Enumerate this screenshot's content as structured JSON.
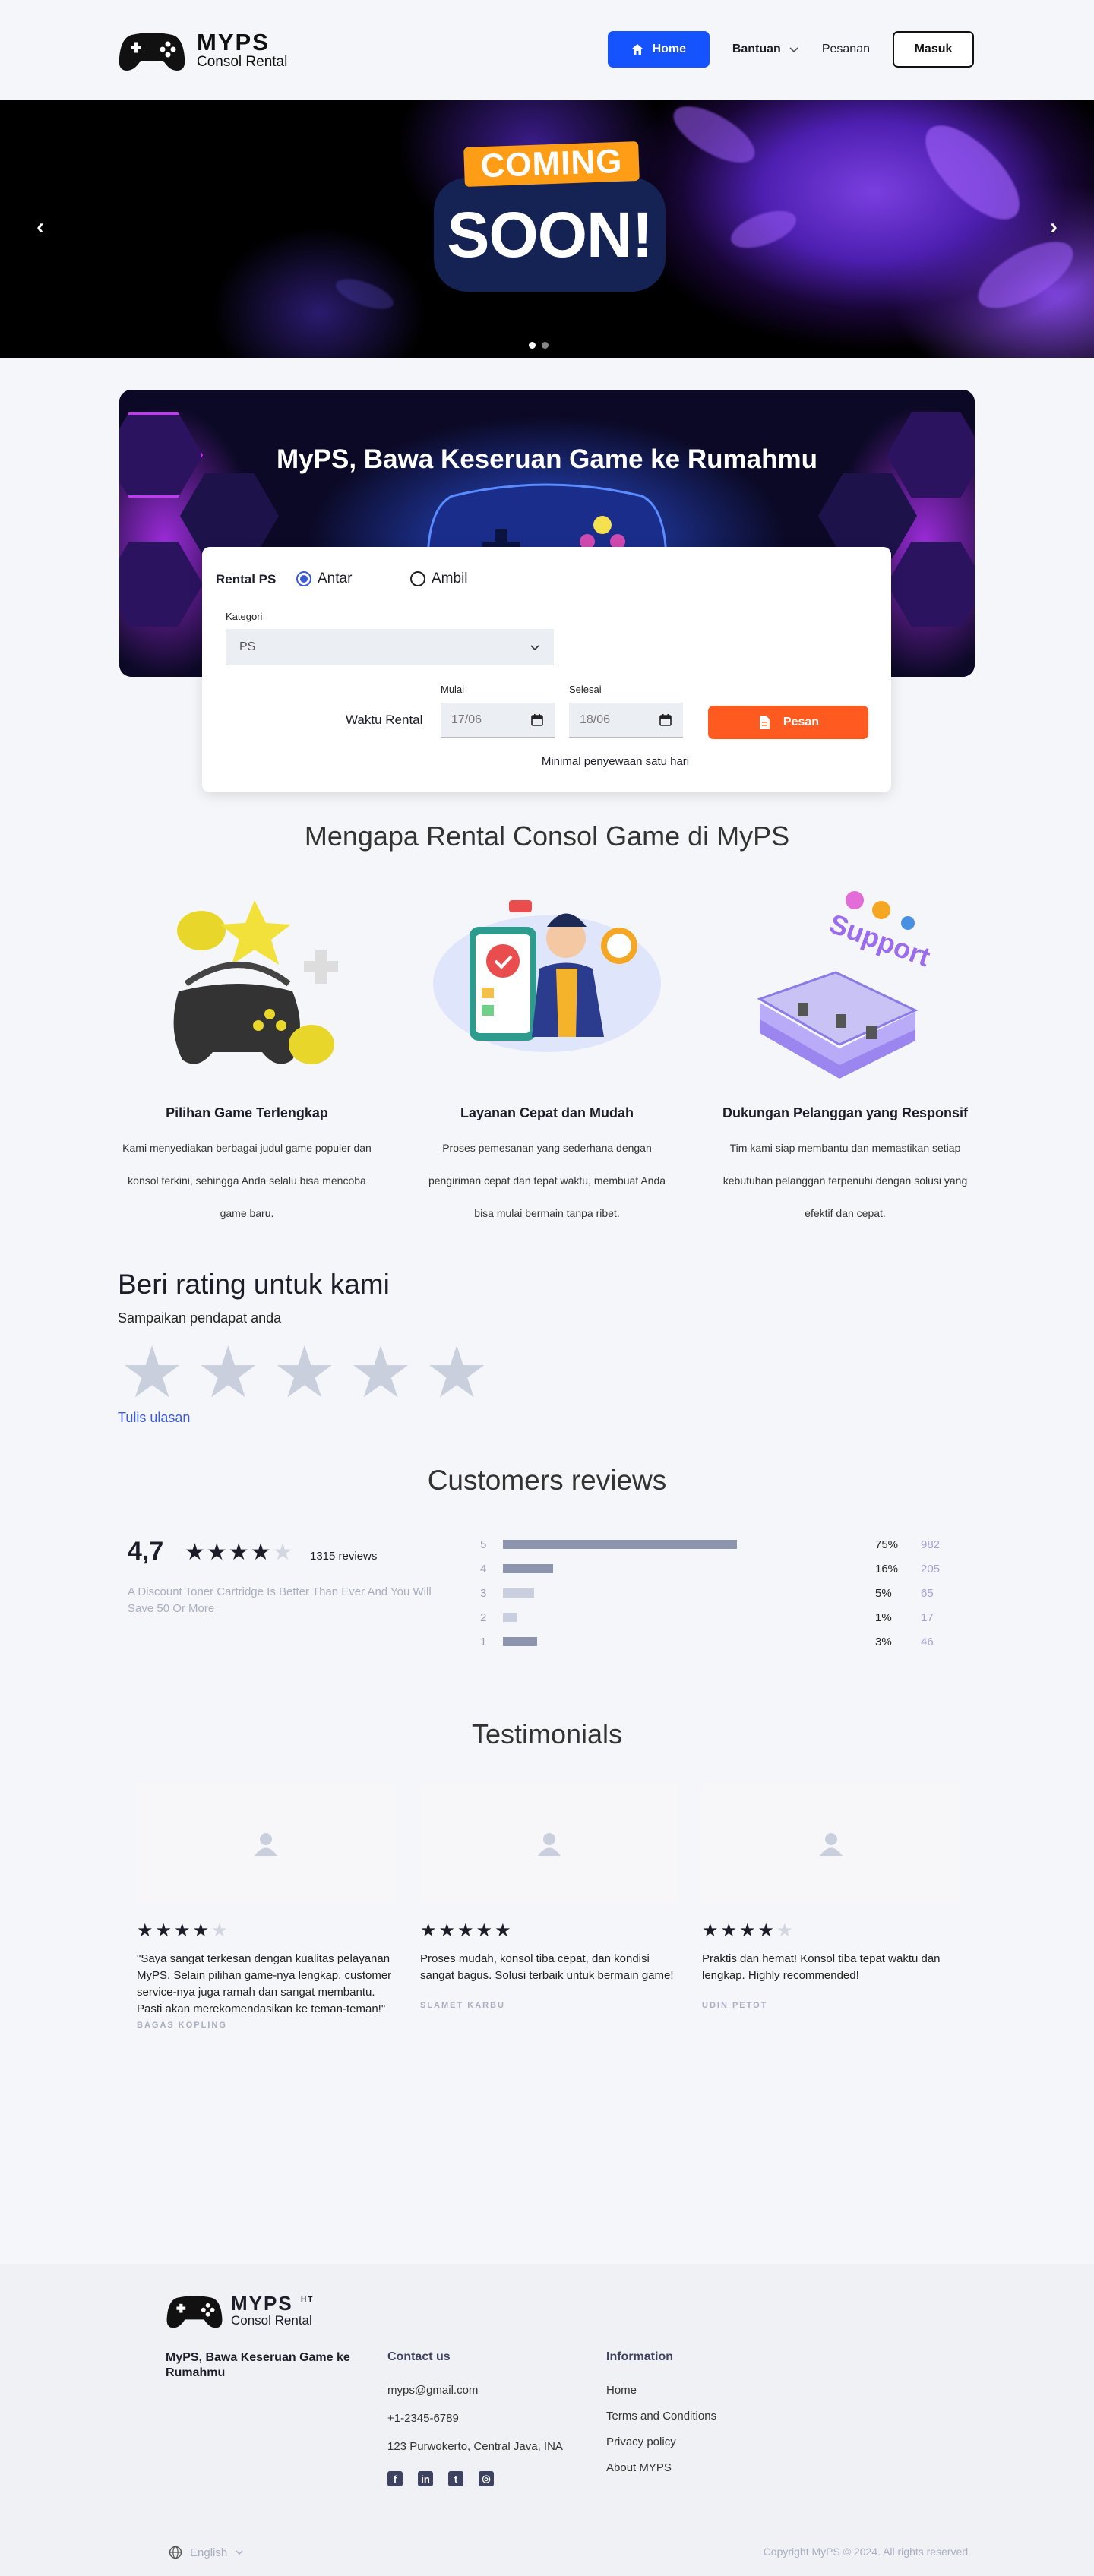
{
  "brand": {
    "name": "MYPS",
    "sub": "Consol Rental",
    "footer_badge": "HT"
  },
  "nav": {
    "home": "Home",
    "help": "Bantuan",
    "orders": "Pesanan",
    "login": "Masuk"
  },
  "hero": {
    "line1": "COMING",
    "line2": "SOON!",
    "slides": 2,
    "active_slide": 1
  },
  "banner": {
    "title": "MyPS, Bawa Keseruan Game ke Rumahmu"
  },
  "booking": {
    "rental_label": "Rental PS",
    "opt_deliver": "Antar",
    "opt_pickup": "Ambil",
    "selected": "Antar",
    "category_label": "Kategori",
    "category_value": "PS",
    "time_label": "Waktu Rental",
    "start_label": "Mulai",
    "start_value": "17/06",
    "end_label": "Selesai",
    "end_value": "18/06",
    "submit": "Pesan",
    "note": "Minimal penyewaan satu hari"
  },
  "why": {
    "title": "Mengapa Rental Consol Game di MyPS",
    "features": [
      {
        "title": "Pilihan Game Terlengkap",
        "text": "Kami menyediakan berbagai judul game populer dan konsol terkini, sehingga Anda selalu bisa mencoba game baru."
      },
      {
        "title": "Layanan Cepat dan Mudah",
        "text": "Proses pemesanan yang sederhana dengan pengiriman cepat dan tepat waktu, membuat Anda bisa mulai bermain tanpa ribet."
      },
      {
        "title": "Dukungan Pelanggan yang Responsif",
        "text": "Tim kami siap membantu dan memastikan setiap kebutuhan pelanggan terpenuhi dengan solusi yang efektif dan cepat."
      }
    ],
    "support_word": "Support"
  },
  "rate": {
    "title": "Beri rating untuk kami",
    "subtitle": "Sampaikan pendapat anda",
    "stars": 5,
    "write": "Tulis ulasan"
  },
  "reviews": {
    "title": "Customers reviews",
    "average": "4,7",
    "average_stars": 4,
    "count": "1315 reviews",
    "promo": "A Discount Toner Cartridge Is Better Than Ever And You Will Save 50 Or More",
    "bars": [
      {
        "star": "5",
        "pct": "75%",
        "count": "982",
        "fraction": 0.75
      },
      {
        "star": "4",
        "pct": "16%",
        "count": "205",
        "fraction": 0.16
      },
      {
        "star": "3",
        "pct": "5%",
        "count": "65",
        "fraction": 0.1
      },
      {
        "star": "2",
        "pct": "1%",
        "count": "17",
        "fraction": 0.045
      },
      {
        "star": "1",
        "pct": "3%",
        "count": "46",
        "fraction": 0.11
      }
    ]
  },
  "testimonials": {
    "title": "Testimonials",
    "items": [
      {
        "stars": 4,
        "quote": "\"Saya sangat terkesan dengan kualitas pelayanan MyPS. Selain pilihan game-nya lengkap, customer service-nya juga ramah dan sangat membantu. Pasti akan merekomendasikan ke teman-teman!\"",
        "name": "BAGAS KOPLING"
      },
      {
        "stars": 5,
        "quote": "Proses mudah, konsol tiba cepat, dan kondisi sangat bagus. Solusi terbaik untuk bermain game!",
        "name": "SLAMET KARBU"
      },
      {
        "stars": 4,
        "quote": "Praktis dan hemat! Konsol tiba tepat waktu dan lengkap. Highly recommended!",
        "name": "UDIN PETOT"
      }
    ]
  },
  "footer": {
    "tagline": "MyPS, Bawa Keseruan Game ke Rumahmu",
    "contact_title": "Contact us",
    "email": "myps@gmail.com",
    "phone": "+1-2345-6789",
    "address": "123 Purwokerto, Central Java, INA",
    "info_title": "Information",
    "links": [
      "Home",
      "Terms and Conditions",
      "Privacy policy",
      "About MYPS"
    ],
    "language": "English",
    "copyright": "Copyright MyPS © 2024. All rights reserved."
  },
  "colors": {
    "primary": "#1453ff",
    "accent": "#ff5a1f",
    "link": "#3b5bdb"
  }
}
